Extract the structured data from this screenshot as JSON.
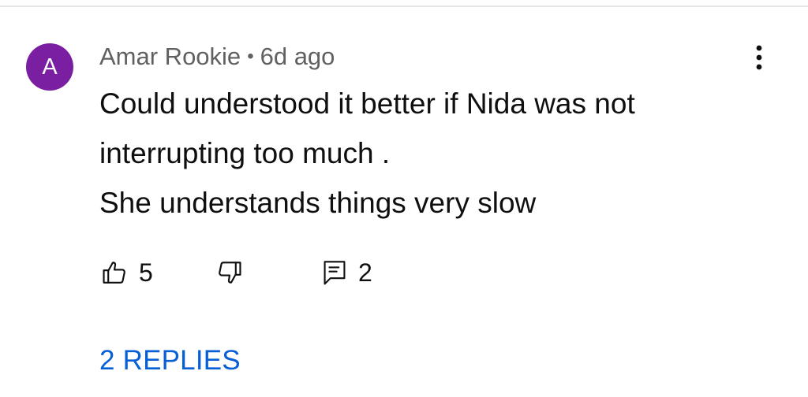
{
  "comment": {
    "avatar_letter": "A",
    "avatar_color": "#7b1fa2",
    "author": "Amar Rookie",
    "separator": "•",
    "time": "6d ago",
    "text_lines": [
      "Could understood it better if Nida was not",
      "interrupting too much .",
      "She understands things very slow"
    ],
    "likes": "5",
    "replies_count": "2",
    "replies_label": "2 REPLIES",
    "link_color": "#065fd4"
  },
  "icons": {
    "like": "thumb-up-icon",
    "dislike": "thumb-down-icon",
    "reply": "reply-comment-icon",
    "menu": "more-vertical-icon"
  }
}
